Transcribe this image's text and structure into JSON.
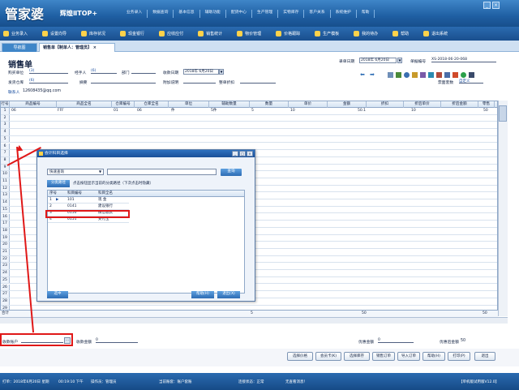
{
  "app": {
    "logo": "管家婆",
    "edition": "辉煌ⅡTOP+",
    "menu": [
      "业务录入",
      "数据查询",
      "基本信息",
      "辅助功能",
      "配货中心",
      "生产管理",
      "实物库存",
      "客户关系",
      "系统维护",
      "帮助"
    ],
    "toolbar": [
      "业务录入",
      "设置向导",
      "库存状况",
      "现金银行",
      "应收应付",
      "销售统计",
      "物价管理",
      "价格跟踪",
      "生产模板",
      "我的待办",
      "帮助",
      "退出系统"
    ]
  },
  "tabs": {
    "home": "导航图",
    "active": "销售单【制单人：管理员】"
  },
  "form": {
    "title": "销售单",
    "buyer_label": "购买单位",
    "buyer_value": "(3)",
    "handler_label": "经手人",
    "handler_value": "(6)",
    "dept_label": "部门",
    "receipt_date_label": "收款日期",
    "receipt_date_value": "2018年 6月20日",
    "warehouse_label": "发货仓库",
    "warehouse_value": "(6)",
    "summary_label": "摘要",
    "note_label": "附加说明",
    "discount_label": "整单折扣",
    "contact_label": "联系人",
    "contact_value": "12608435@qq.com",
    "record_date_label": "录单日期",
    "record_date_value": "2018年 6月20日",
    "doc_no_label": "单据编号",
    "doc_no_value": "XS-2018-06-20-068",
    "fmt_label": "票面套数",
    "fmt_value": "自定义"
  },
  "grid": {
    "headers": [
      "行号",
      "商品编号",
      "商品全名",
      "仓库编号",
      "仓库全名",
      "单位",
      "辅助数量",
      "数量",
      "单价",
      "金额",
      "折扣",
      "折后单价",
      "折后金额",
      "零售"
    ],
    "row1": {
      "num": "1",
      "code": "06",
      "name": "FFF",
      "wh_code": "01",
      "wh_name": "06",
      "unit": "件",
      "aux": "5件",
      "qty": "5",
      "price": "10",
      "amount": "50.1",
      "discount": "10",
      "disc_amount": "50"
    },
    "row_numbers": [
      "1",
      "2",
      "3",
      "4",
      "5",
      "6",
      "7",
      "8",
      "9",
      "10",
      "11",
      "12",
      "13",
      "14",
      "15",
      "16",
      "17",
      "18",
      "19",
      "20",
      "21",
      "22",
      "23",
      "24",
      "25",
      "26",
      "27",
      "28",
      "29",
      "30"
    ],
    "sum_label": "合计",
    "sum_qty": "5",
    "sum_amount": "50",
    "sum_disc": "50"
  },
  "bottom": {
    "account_label": "收款账户",
    "account_value": "",
    "recv_label": "收款金额",
    "recv_value": "0",
    "pre_label": "优惠金额",
    "pre_value": "0",
    "final_label": "优惠后金额",
    "final_value": "50"
  },
  "buttons": [
    "选择价格",
    "会员卡(K)",
    "选择库存",
    "销售订单",
    "导入订单",
    "帮助(H)",
    "打印(P)",
    "退出"
  ],
  "status": {
    "date": "打单：2018年6月20日 星期",
    "time": "00:19:10 下午",
    "operator": "操作员：管理员",
    "account": "当前账套：账户套账",
    "state": "连接状态：正常",
    "msg": "无查看消息！",
    "version": "【单机版试用版V12.0】"
  },
  "dialog": {
    "title": "会计科目选择",
    "query_mode": "快速查询",
    "query_btn": "查询",
    "class_btn": "分类路径",
    "hint": "点击按钮显示当前的分类路径（下次点击时隐藏）",
    "headers": [
      "序号",
      "科目编号",
      "科目全名"
    ],
    "rows": [
      {
        "n": "1",
        "code": "101",
        "name": "现 金"
      },
      {
        "n": "2",
        "code": "0141",
        "name": "建设银行"
      },
      {
        "n": "3",
        "code": "0150",
        "name": "微信收款"
      },
      {
        "n": "4",
        "code": "0151",
        "name": "支付宝"
      }
    ],
    "ok": "选中",
    "help": "帮助(H)",
    "exit": "退出(X)"
  }
}
